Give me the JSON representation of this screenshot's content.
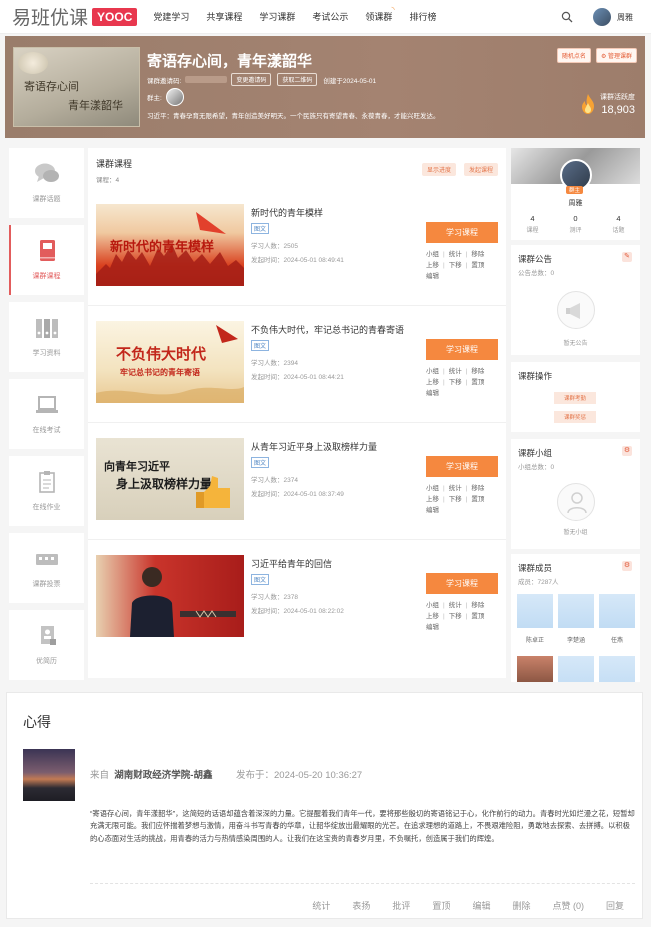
{
  "nav": {
    "logo_text": "易班优课",
    "logo_badge": "YOOC",
    "items": [
      "党建学习",
      "共享课程",
      "学习课群",
      "考试公示",
      "领课群",
      "排行榜"
    ],
    "user_name": "周雅"
  },
  "banner": {
    "image_line1": "寄语存心间",
    "image_line2": "青年漾韶华",
    "title": "寄语存心间，青年漾韶华",
    "invite_label": "课群邀请码:",
    "change_code": "变更邀请码",
    "qr_code": "获取二维码",
    "created": "创建于2024-05-01",
    "owner_label": "群主:",
    "desc": "习近平：青春孕育无限希望，青年创造美好明天。一个民族只有寄望青春、永葆青春，才能兴旺发达。",
    "action_random": "随机点名",
    "action_manage": "管理课群",
    "active_label": "课群活跃度",
    "active_value": "18,903"
  },
  "sidebar": {
    "items": [
      "课群话题",
      "课群课程",
      "学习资料",
      "在线考试",
      "在线作业",
      "课群投票",
      "优简历"
    ]
  },
  "main": {
    "title": "课群课程",
    "count": "课程：4",
    "show_progress": "显示进度",
    "publish": "发起课程",
    "tag_label": "图文",
    "btn_label": "学习课程",
    "ops": {
      "group": "小组",
      "stats": "统计",
      "remove": "移除",
      "up": "上移",
      "down": "下移",
      "top": "置顶",
      "edit": "编辑"
    },
    "courses": [
      {
        "title": "新时代的青年模样",
        "learners": "学习人数：2505",
        "date": "发起时间：2024-05-01 08:49:41",
        "img_text": "新时代的青年模样"
      },
      {
        "title": "不负伟大时代，牢记总书记的青春寄语",
        "learners": "学习人数：2394",
        "date": "发起时间：2024-05-01 08:44:21",
        "img_text": "不负伟大时代",
        "img_sub": "牢记总书记的青年寄语"
      },
      {
        "title": "从青年习近平身上汲取榜样力量",
        "learners": "学习人数：2374",
        "date": "发起时间：2024-05-01 08:37:49",
        "img_text": "向青年习近平",
        "img_sub": "身上汲取榜样力量"
      },
      {
        "title": "习近平给青年的回信",
        "learners": "学习人数：2378",
        "date": "发起时间：2024-05-01 08:22:02"
      }
    ]
  },
  "right": {
    "owner_tag": "群主",
    "owner_name": "周雅",
    "stats": [
      {
        "value": "4",
        "label": "课程"
      },
      {
        "value": "0",
        "label": "测评"
      },
      {
        "value": "4",
        "label": "话题"
      }
    ],
    "notice_title": "课群公告",
    "notice_count": "公告总数：0",
    "notice_empty": "暂无公告",
    "ops_title": "课群操作",
    "ops_btn1": "课群考勤",
    "ops_btn2": "课群奖惩",
    "group_title": "课群小组",
    "group_count": "小组总数：0",
    "group_empty": "暂无小组",
    "member_title": "课群成员",
    "member_count": "成员：7287人",
    "members": [
      "陈卓正",
      "李楚涵",
      "任燕"
    ]
  },
  "bottom": {
    "title": "心得",
    "from_label": "来自",
    "from_value": "湖南财政经济学院-胡鑫",
    "date": "发布于：2024-05-20 10:36:27",
    "text": "“寄语存心间，青年漾韶华”，这简短的话语却蕴含着深深的力量。它提醒着我们青年一代，要将那些殷切的寄语铭记于心，化作前行的动力。青春时光如烂漫之花，短暂却充满无限可能。我们应怀揣着梦想与激情，用奋斗书写青春的华章，让韶华绽放出最耀眼的光芒。在追求理想的道路上，不畏艰难险阻，勇敢地去探索、去拼搏。以积极的心态面对生活的挑战，用青春的活力与热情感染周围的人。让我们在这宝贵的青春岁月里，不负嘱托，创造属于我们的辉煌。",
    "ops": [
      "统计",
      "表扬",
      "批评",
      "置顶",
      "编辑",
      "删除",
      "点赞 (0)",
      "回复"
    ]
  },
  "colors": {
    "accent": "#f5883f",
    "brand_red": "#e8374e",
    "banner_bg": "#a48371"
  }
}
